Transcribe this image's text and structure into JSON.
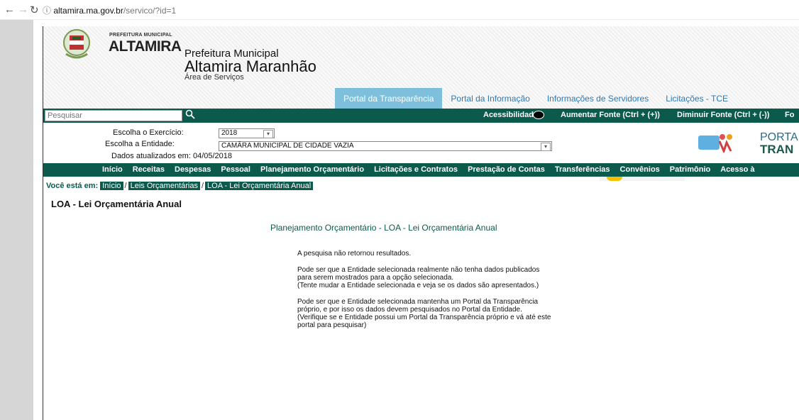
{
  "browser": {
    "host": "altamira.ma.gov.br",
    "path": "/servico/?id=1"
  },
  "header": {
    "logo_small": "PREFEITURA MUNICIPAL",
    "logo_big": "ALTAMIRA",
    "prefeitura": "Prefeitura Municipal",
    "municipio": "Altamira Maranhão",
    "area": "Área de Serviços",
    "tabs": [
      {
        "label": "Portal da Transparência",
        "active": true
      },
      {
        "label": "Portal da Informação"
      },
      {
        "label": "Informações de Servidores"
      },
      {
        "label": "Licitações - TCE"
      }
    ]
  },
  "toolbar": {
    "search_placeholder": "Pesquisar",
    "acessibilidade": "Acessibilidade:",
    "aumentar": "Aumentar Fonte (Ctrl + (+))",
    "diminuir": "Diminuir Fonte (Ctrl + (-))",
    "extra": "Fo"
  },
  "filters": {
    "exercicio_label": "Escolha o Exercício:",
    "exercicio_value": "2018",
    "entidade_label": "Escolha a Entidade:",
    "entidade_value": "CAMÂRA MUNICIPAL DE CIDADE VAZIA",
    "atualizados": "Dados atualizados em: 04/05/2018"
  },
  "portal_logo": {
    "line1": "PORTA",
    "line2": "TRAN"
  },
  "menu": [
    "Início",
    "Receitas",
    "Despesas",
    "Pessoal",
    "Planejamento Orçamentário",
    "Licitações e Contratos",
    "Prestação de Contas",
    "Transferências",
    "Convênios",
    "Patrimônio",
    "Acesso à"
  ],
  "breadcrumb": {
    "label": "Você está em:",
    "items": [
      "Início",
      "Leis Orçamentárias",
      "LOA - Lei Orçamentária Anual"
    ],
    "sep": "/"
  },
  "page": {
    "title": "LOA - Lei Orçamentária Anual",
    "subtitle": "Planejamento Orçamentário - LOA - Lei Orçamentária Anual",
    "msg1": "A pesquisa não retornou resultados.",
    "msg2a": "Pode ser que a Entidade selecionada realmente não tenha dados publicados",
    "msg2b": "para serem mostrados para a opção selecionada.",
    "msg2c": "(Tente mudar a Entidade selecionada e veja se os dados são apresentados.)",
    "msg3a": "Pode ser que e Entidade selecionada mantenha um Portal da Transparência",
    "msg3b": "próprio, e por isso os dados devem pesquisados no Portal da Entidade.",
    "msg3c": "(Verifique se e Entidade possui um Portal da Transparência próprio e vá até este",
    "msg3d": "portal para pesquisar)"
  }
}
